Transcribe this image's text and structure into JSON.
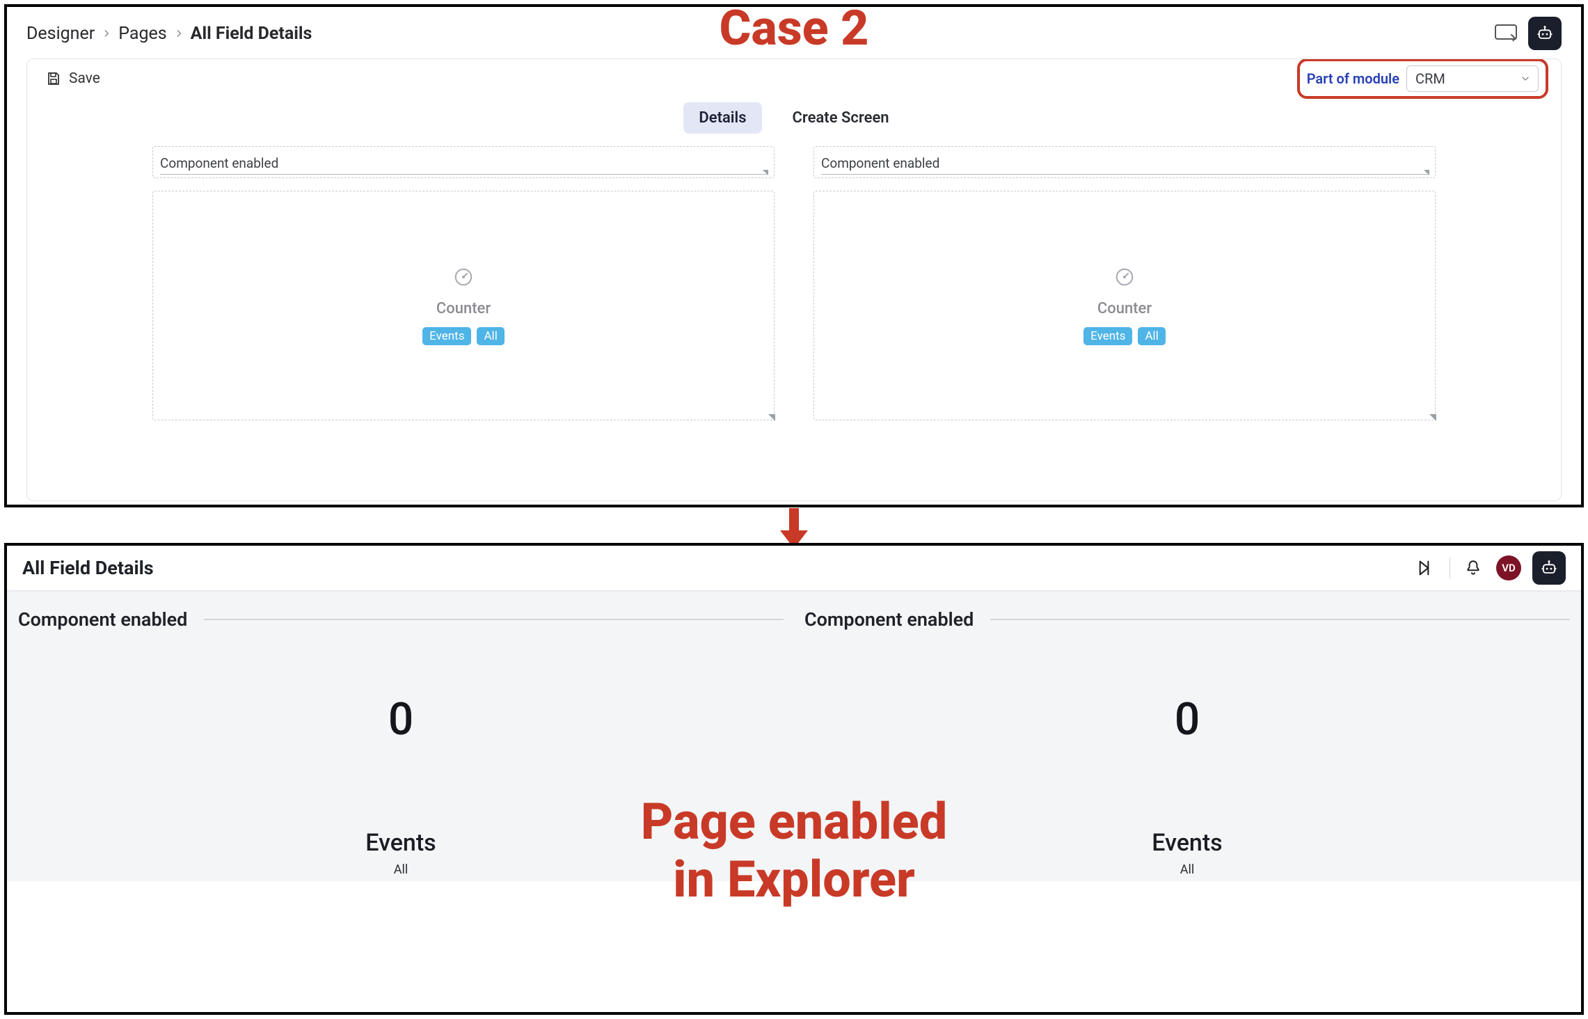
{
  "annotations": {
    "case_label": "Case 2",
    "page_enabled_line1": "Page enabled",
    "page_enabled_line2": "in Explorer"
  },
  "designer": {
    "breadcrumbs": {
      "root": "Designer",
      "level1": "Pages",
      "current": "All Field Details"
    },
    "toolbar": {
      "save_label": "Save",
      "module_label": "Part of module",
      "module_value": "CRM"
    },
    "tabs": {
      "details": "Details",
      "create_screen": "Create Screen"
    },
    "columns": [
      {
        "field_label": "Component enabled",
        "counter_label": "Counter",
        "tag1": "Events",
        "tag2": "All"
      },
      {
        "field_label": "Component enabled",
        "counter_label": "Counter",
        "tag1": "Events",
        "tag2": "All"
      }
    ]
  },
  "explorer": {
    "title": "All Field Details",
    "avatar_initials": "VD",
    "stats": [
      {
        "label": "Component enabled",
        "value": "0",
        "events": "Events",
        "all": "All"
      },
      {
        "label": "Component enabled",
        "value": "0",
        "events": "Events",
        "all": "All"
      }
    ]
  }
}
